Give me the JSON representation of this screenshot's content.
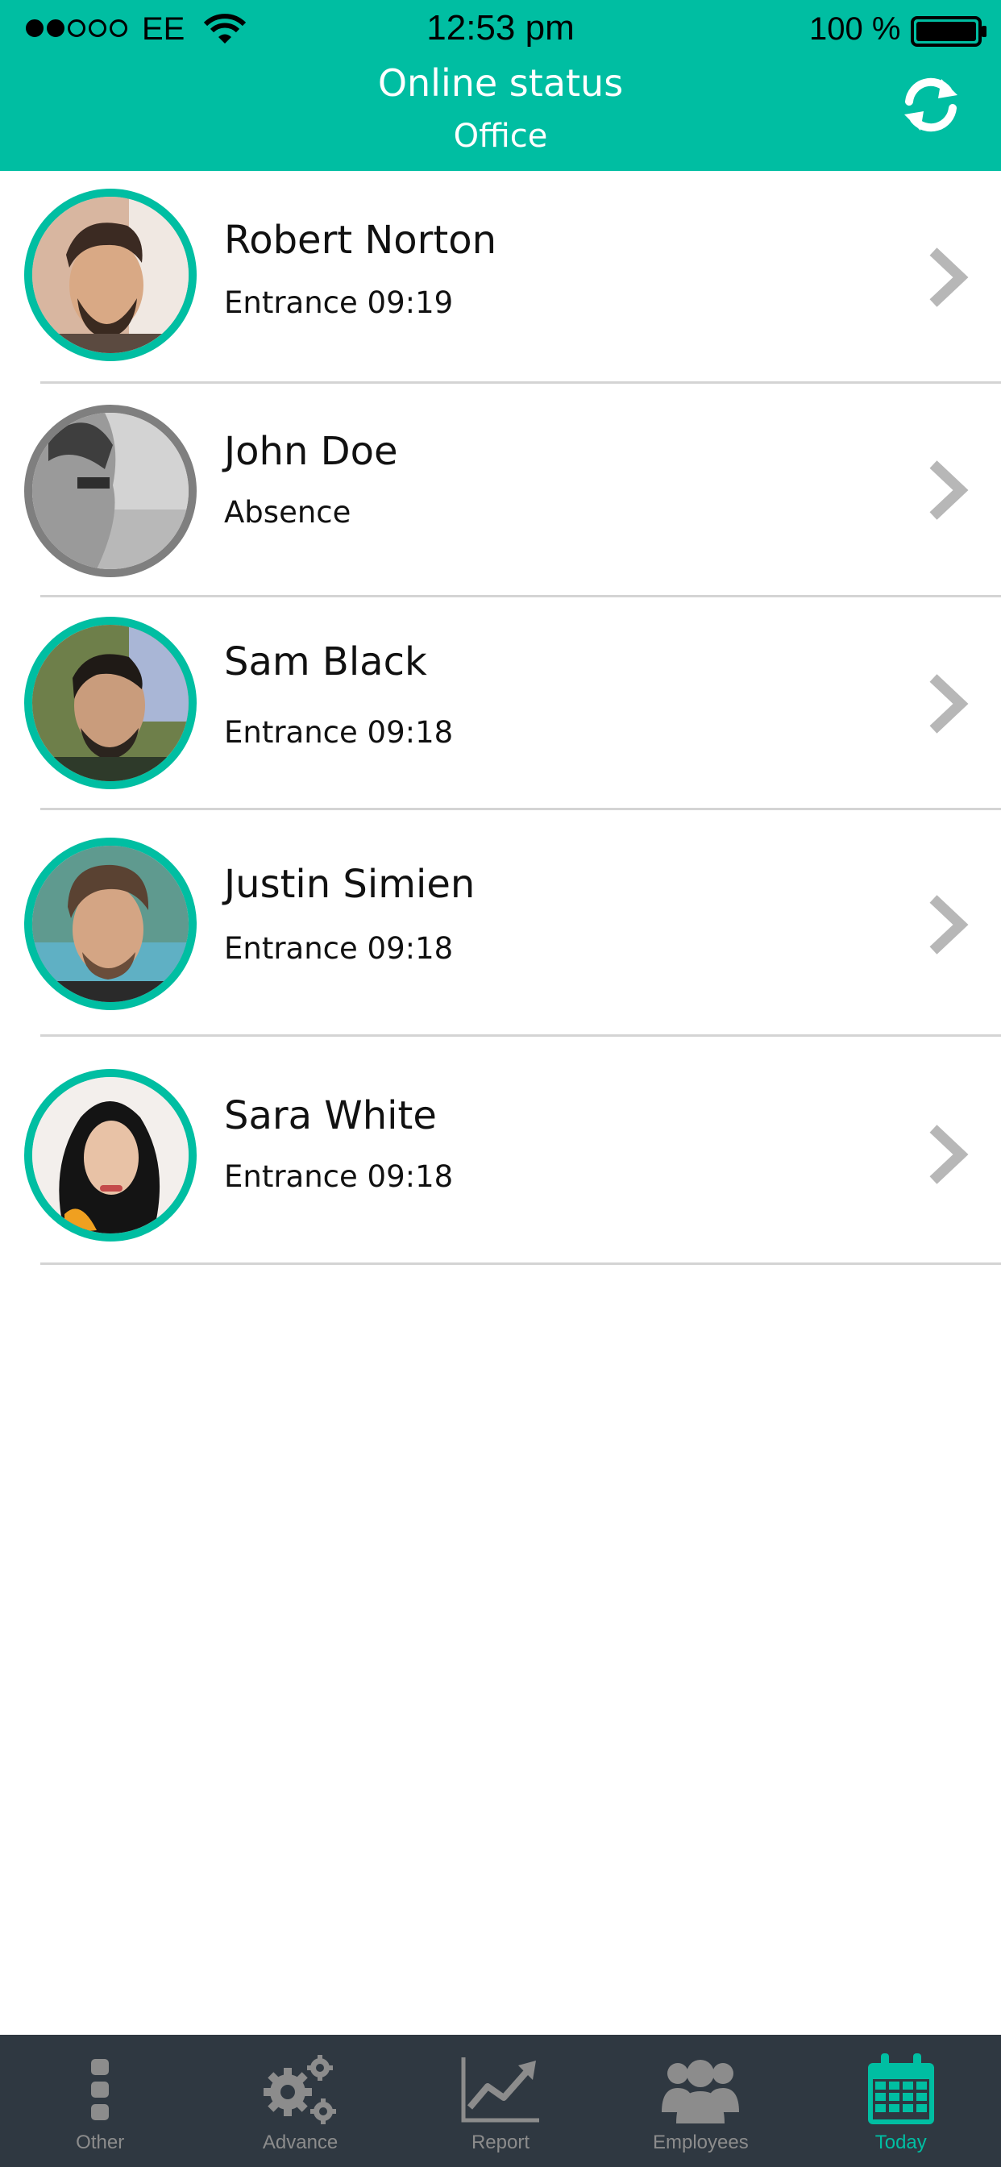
{
  "status_bar": {
    "carrier": "EE",
    "time": "12:53  pm",
    "battery_text": "100 %"
  },
  "header": {
    "title": "Online status",
    "subtitle": "Office",
    "refresh_icon": "refresh-icon",
    "background_color": "#00bea2"
  },
  "employees": [
    {
      "name": "Robert Norton",
      "status": "Entrance 09:19",
      "online": true
    },
    {
      "name": "John Doe",
      "status": "Absence",
      "online": false
    },
    {
      "name": "Sam Black",
      "status": "Entrance 09:18",
      "online": true
    },
    {
      "name": "Justin Simien",
      "status": "Entrance 09:18",
      "online": true
    },
    {
      "name": "Sara White",
      "status": "Entrance 09:18",
      "online": true
    }
  ],
  "colors": {
    "accent": "#00bea2",
    "absent_ring": "#7f7f7f",
    "tabbar_bg": "#2f3841",
    "tab_inactive": "#8c8c8c"
  },
  "tabbar": {
    "tabs": [
      {
        "label": "Other",
        "icon": "more-vertical-icon",
        "active": false
      },
      {
        "label": "Advance",
        "icon": "gears-icon",
        "active": false
      },
      {
        "label": "Report",
        "icon": "chart-icon",
        "active": false
      },
      {
        "label": "Employees",
        "icon": "people-icon",
        "active": false
      },
      {
        "label": "Today",
        "icon": "calendar-icon",
        "active": true
      }
    ]
  }
}
